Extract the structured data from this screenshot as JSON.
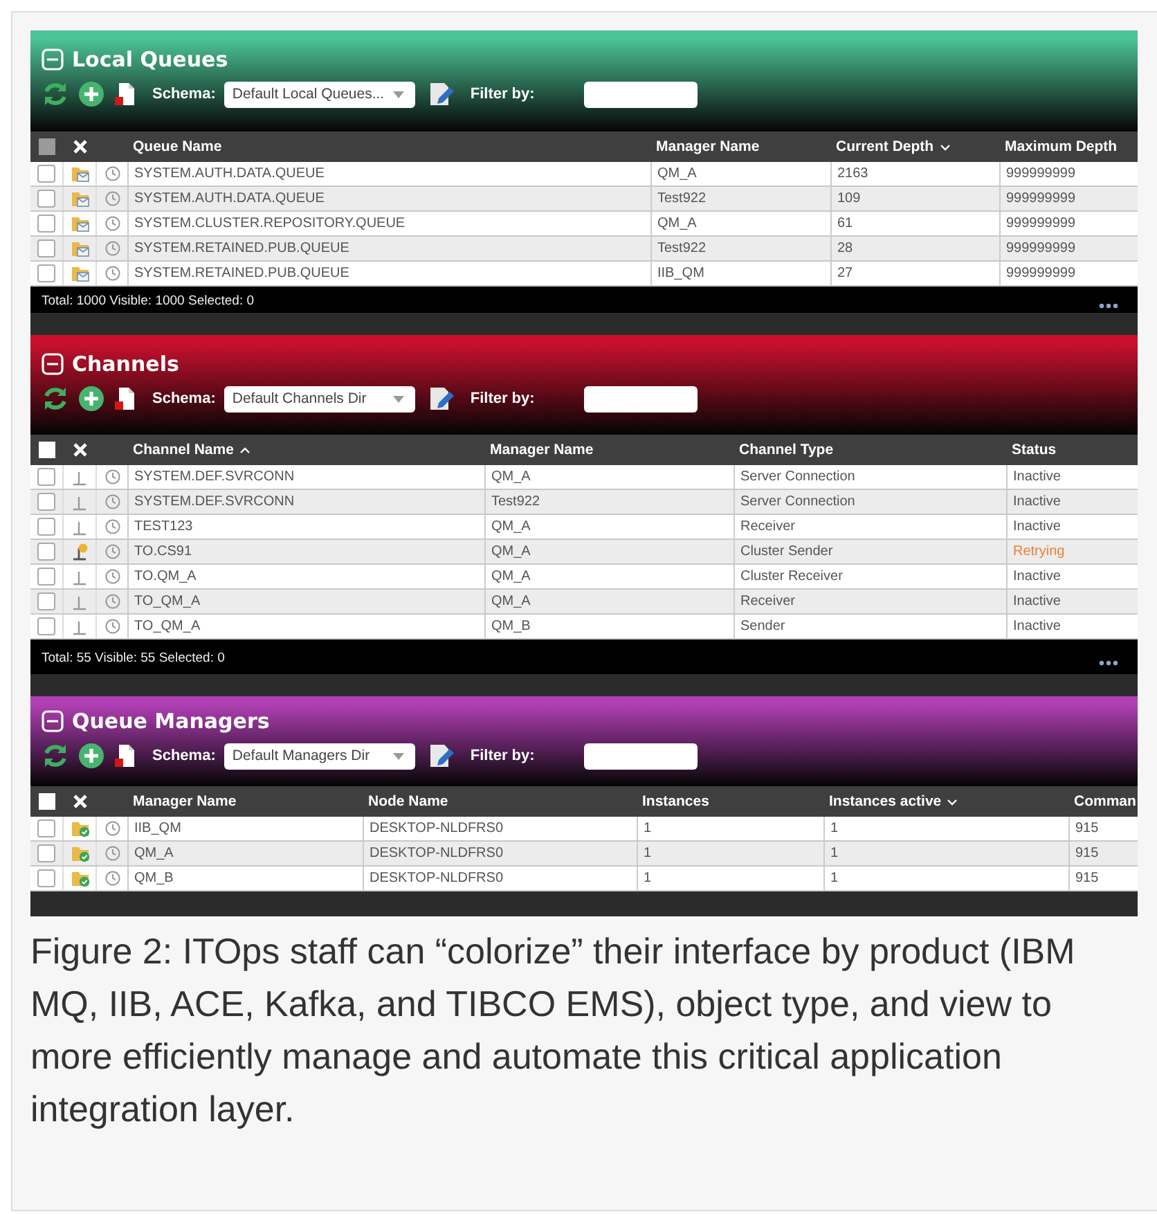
{
  "panels": [
    {
      "title": "Local Queues",
      "kind": "queues",
      "color": "#4cc497",
      "schema_label": "Schema:",
      "schema": "Default Local Queues...",
      "filter_label": "Filter by:",
      "select_all": {
        "checked": false,
        "disabled": true
      },
      "columns": [
        {
          "label": "Queue Name",
          "sorted": false
        },
        {
          "label": "Manager Name",
          "sorted": false
        },
        {
          "label": "Current Depth",
          "sorted": true,
          "descending": true
        },
        {
          "label": "Maximum Depth",
          "sorted": false
        }
      ],
      "rows": [
        {
          "checked": false,
          "cells": [
            "SYSTEM.AUTH.DATA.QUEUE",
            "QM_A",
            "2163",
            "999999999"
          ],
          "warning": false
        },
        {
          "checked": false,
          "cells": [
            "SYSTEM.AUTH.DATA.QUEUE",
            "Test922",
            "109",
            "999999999"
          ],
          "warning": false
        },
        {
          "checked": false,
          "cells": [
            "SYSTEM.CLUSTER.REPOSITORY.QUEUE",
            "QM_A",
            "61",
            "999999999"
          ],
          "warning": false
        },
        {
          "checked": false,
          "cells": [
            "SYSTEM.RETAINED.PUB.QUEUE",
            "Test922",
            "28",
            "999999999"
          ],
          "warning": false
        },
        {
          "checked": false,
          "cells": [
            "SYSTEM.RETAINED.PUB.QUEUE",
            "IIB_QM",
            "27",
            "999999999"
          ],
          "warning": false
        }
      ],
      "footer": "Total: 1000 Visible: 1000 Selected: 0"
    },
    {
      "title": "Channels",
      "kind": "channels",
      "color": "#c8102e",
      "schema_label": "Schema:",
      "schema": "Default Channels Dir",
      "filter_label": "Filter by:",
      "select_all": {
        "checked": false,
        "disabled": false
      },
      "columns": [
        {
          "label": "Channel Name",
          "sorted": true,
          "descending": false
        },
        {
          "label": "Manager Name",
          "sorted": false
        },
        {
          "label": "Channel Type",
          "sorted": false
        },
        {
          "label": "Status",
          "sorted": false
        }
      ],
      "rows": [
        {
          "checked": false,
          "cells": [
            "SYSTEM.DEF.SVRCONN",
            "QM_A",
            "Server Connection",
            "Inactive"
          ],
          "warning": false
        },
        {
          "checked": false,
          "cells": [
            "SYSTEM.DEF.SVRCONN",
            "Test922",
            "Server Connection",
            "Inactive"
          ],
          "warning": false
        },
        {
          "checked": false,
          "cells": [
            "TEST123",
            "QM_A",
            "Receiver",
            "Inactive"
          ],
          "warning": false
        },
        {
          "checked": false,
          "cells": [
            "TO.CS91",
            "QM_A",
            "Cluster Sender",
            "Retrying"
          ],
          "warning": true
        },
        {
          "checked": false,
          "cells": [
            "TO.QM_A",
            "QM_A",
            "Cluster Receiver",
            "Inactive"
          ],
          "warning": false
        },
        {
          "checked": false,
          "cells": [
            "TO_QM_A",
            "QM_A",
            "Receiver",
            "Inactive"
          ],
          "warning": false
        },
        {
          "checked": false,
          "cells": [
            "TO_QM_A",
            "QM_B",
            "Sender",
            "Inactive"
          ],
          "warning": false
        }
      ],
      "footer": "Total: 55 Visible: 55 Selected: 0"
    },
    {
      "title": "Queue Managers",
      "kind": "managers",
      "color": "#b23fb5",
      "schema_label": "Schema:",
      "schema": "Default Managers Dir",
      "filter_label": "Filter by:",
      "select_all": {
        "checked": false,
        "disabled": false
      },
      "columns": [
        {
          "label": "Manager Name",
          "sorted": false
        },
        {
          "label": "Node Name",
          "sorted": false
        },
        {
          "label": "Instances",
          "sorted": false
        },
        {
          "label": "Instances active",
          "sorted": true,
          "descending": true
        },
        {
          "label": "Comman",
          "sorted": false
        }
      ],
      "rows": [
        {
          "checked": false,
          "cells": [
            "IIB_QM",
            "DESKTOP-NLDFRS0",
            "1",
            "1",
            "915"
          ],
          "warning": false
        },
        {
          "checked": false,
          "cells": [
            "QM_A",
            "DESKTOP-NLDFRS0",
            "1",
            "1",
            "915"
          ],
          "warning": false
        },
        {
          "checked": false,
          "cells": [
            "QM_B",
            "DESKTOP-NLDFRS0",
            "1",
            "1",
            "915"
          ],
          "warning": false
        }
      ]
    }
  ],
  "caption": "Figure 2: ITOps staff can “colorize” their interface by product (IBM MQ, IIB, ACE, Kafka, and TIBCO EMS), object type, and view to more efficiently manage and automate this critical application integration layer."
}
